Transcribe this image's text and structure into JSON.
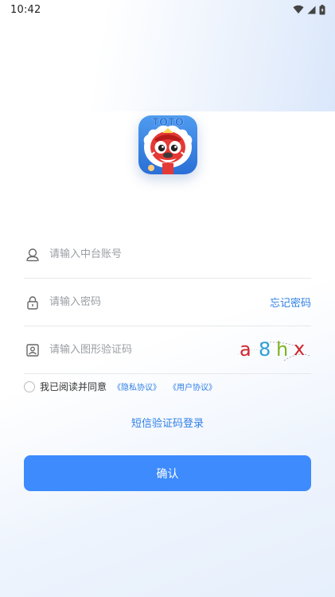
{
  "status_bar": {
    "time": "10:42"
  },
  "login_form": {
    "account_placeholder": "请输入中台账号",
    "password_placeholder": "请输入密码",
    "forgot_password": "忘记密码",
    "captcha_placeholder": "请输入图形验证码",
    "captcha_chars": [
      "a",
      "8",
      "h",
      "x"
    ],
    "captcha_colors": [
      "#d1262d",
      "#2e9fd8",
      "#7fb524",
      "#d1262d"
    ]
  },
  "agreement": {
    "text": "我已阅读并同意",
    "privacy_link": "《隐私协议》",
    "user_link": "《用户协议》"
  },
  "sms_login_label": "短信验证码登录",
  "confirm_label": "确认",
  "colors": {
    "accent": "#3d8bfd",
    "link": "#2f7fe6"
  }
}
